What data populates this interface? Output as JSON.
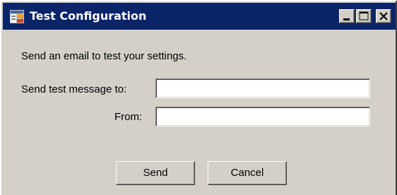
{
  "window": {
    "title": "Test Configuration",
    "buttons": {
      "minimize_icon": "minimize-icon",
      "maximize_icon": "maximize-icon",
      "close_icon": "close-icon"
    },
    "colors": {
      "titlebar": "#0a246a",
      "face": "#d4d0c8"
    }
  },
  "dialog": {
    "intro_text": "Send an email to test your settings.",
    "to_label": "Send test message to:",
    "to_value": "",
    "from_label": "From:",
    "from_value": "",
    "send_label": "Send",
    "cancel_label": "Cancel"
  }
}
